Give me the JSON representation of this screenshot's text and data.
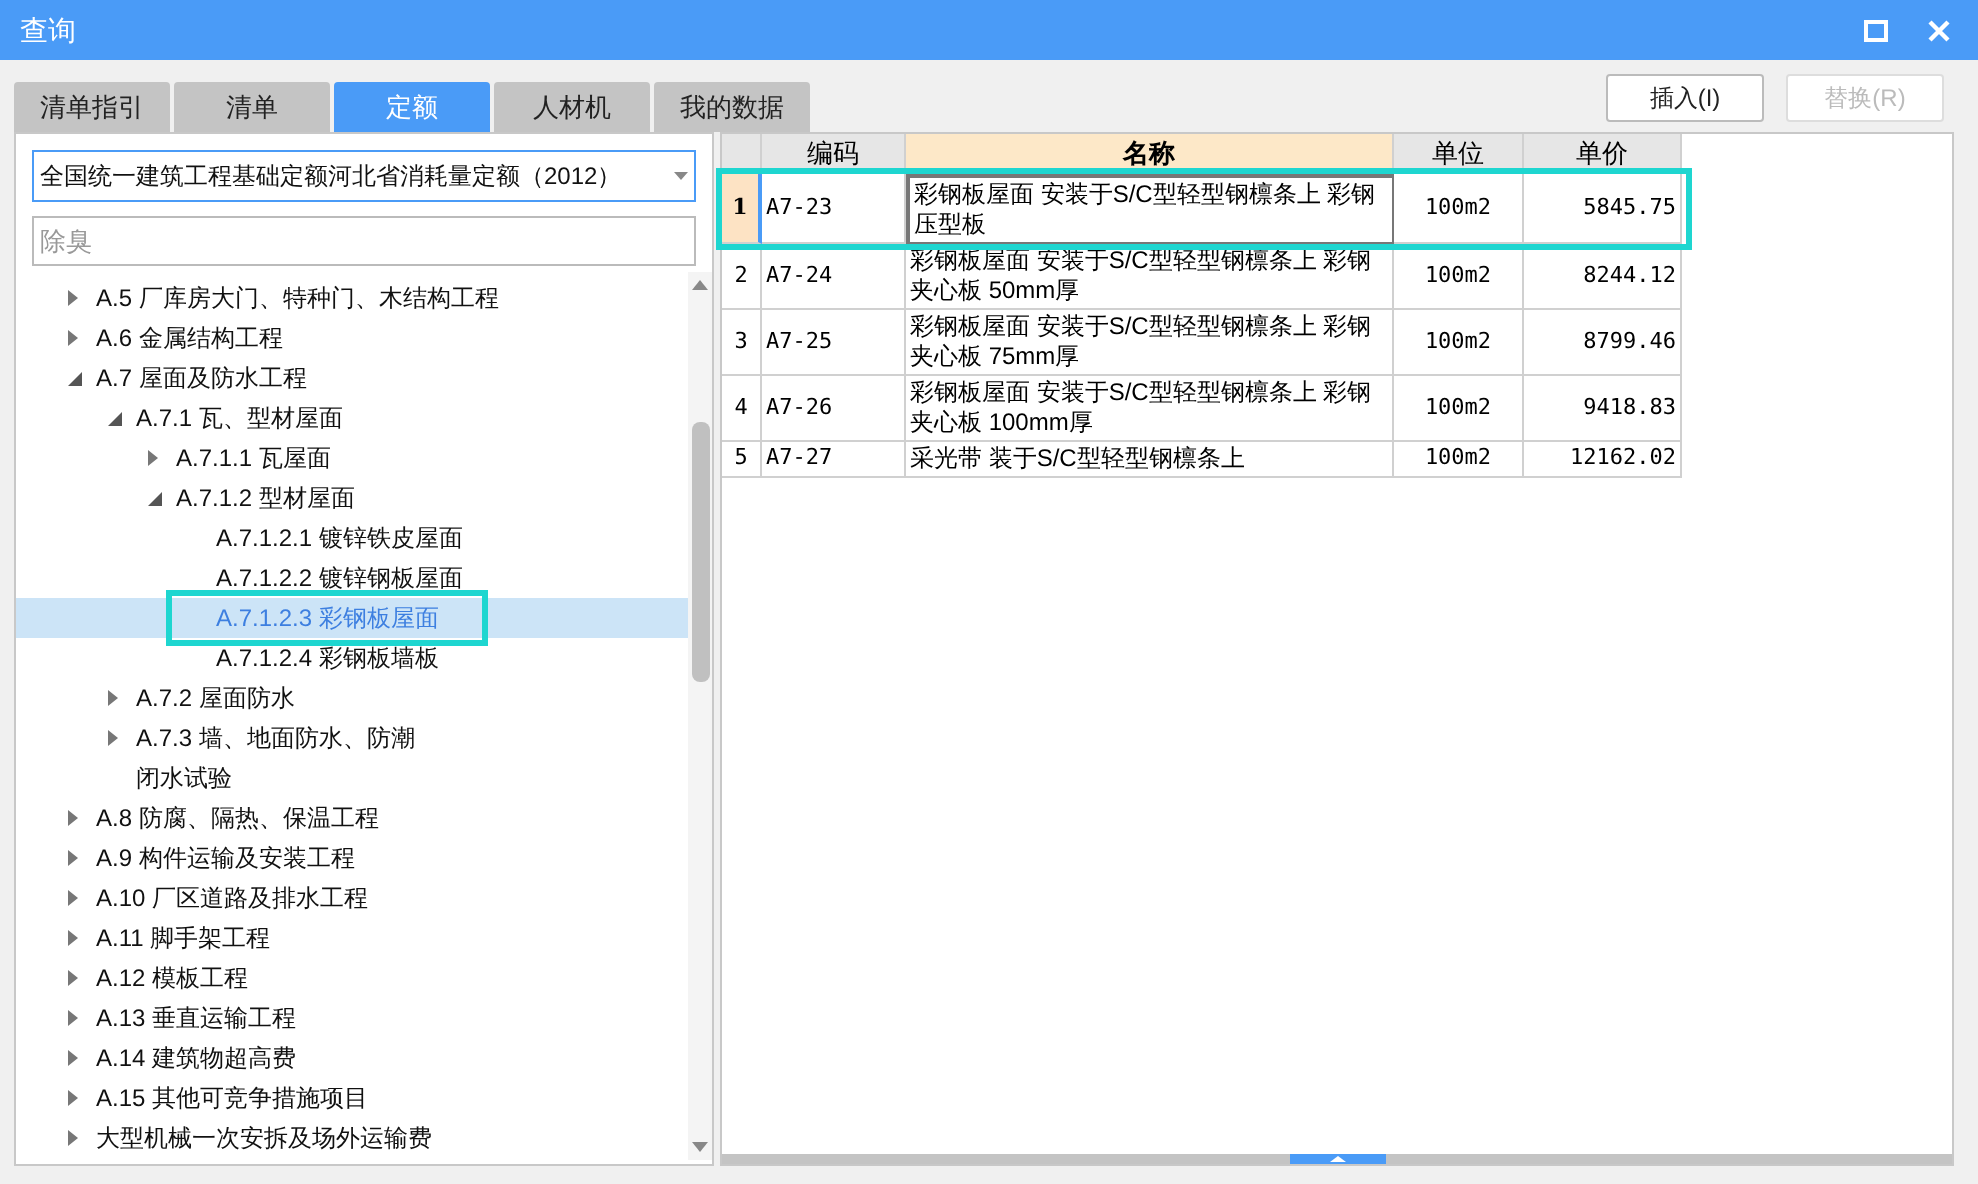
{
  "window": {
    "title": "查询"
  },
  "tabs": [
    {
      "label": "清单指引",
      "selected": false
    },
    {
      "label": "清单",
      "selected": false
    },
    {
      "label": "定额",
      "selected": true
    },
    {
      "label": "人材机",
      "selected": false
    },
    {
      "label": "我的数据",
      "selected": false
    }
  ],
  "buttons": [
    {
      "label": "插入(I)",
      "disabled": false
    },
    {
      "label": "替换(R)",
      "disabled": true
    }
  ],
  "quota_select": {
    "value": "全国统一建筑工程基础定额河北省消耗量定额（2012）"
  },
  "search": {
    "value": "除臭"
  },
  "tree": [
    {
      "label": "A.5 厂库房大门、特种门、木结构工程",
      "expanded": false,
      "selected": false
    },
    {
      "label": "A.6 金属结构工程",
      "expanded": false,
      "selected": false
    },
    {
      "label": "A.7 屋面及防水工程",
      "expanded": true,
      "selected": false,
      "children": [
        {
          "label": "A.7.1 瓦、型材屋面",
          "expanded": true,
          "selected": false,
          "children": [
            {
              "label": "A.7.1.1 瓦屋面",
              "expanded": false,
              "selected": false
            },
            {
              "label": "A.7.1.2 型材屋面",
              "expanded": true,
              "selected": false,
              "children": [
                {
                  "label": "A.7.1.2.1 镀锌铁皮屋面",
                  "selected": false
                },
                {
                  "label": "A.7.1.2.2 镀锌钢板屋面",
                  "selected": false
                },
                {
                  "label": "A.7.1.2.3 彩钢板屋面",
                  "selected": true,
                  "marked": true
                },
                {
                  "label": "A.7.1.2.4 彩钢板墙板",
                  "selected": false
                }
              ]
            }
          ]
        },
        {
          "label": "A.7.2 屋面防水",
          "expanded": false,
          "selected": false
        },
        {
          "label": "A.7.3 墙、地面防水、防潮",
          "expanded": false,
          "selected": false
        },
        {
          "label": "闭水试验",
          "selected": false
        }
      ]
    },
    {
      "label": "A.8 防腐、隔热、保温工程",
      "expanded": false,
      "selected": false
    },
    {
      "label": "A.9 构件运输及安装工程",
      "expanded": false,
      "selected": false
    },
    {
      "label": "A.10 厂区道路及排水工程",
      "expanded": false,
      "selected": false
    },
    {
      "label": "A.11 脚手架工程",
      "expanded": false,
      "selected": false
    },
    {
      "label": "A.12 模板工程",
      "expanded": false,
      "selected": false
    },
    {
      "label": "A.13 垂直运输工程",
      "expanded": false,
      "selected": false
    },
    {
      "label": "A.14 建筑物超高费",
      "expanded": false,
      "selected": false
    },
    {
      "label": "A.15 其他可竞争措施项目",
      "expanded": false,
      "selected": false
    },
    {
      "label": "大型机械一次安拆及场外运输费",
      "expanded": false,
      "selected": false
    }
  ],
  "table": {
    "columns": [
      {
        "label": "编码",
        "selected": false
      },
      {
        "label": "名称",
        "selected": true
      },
      {
        "label": "单位",
        "selected": false
      },
      {
        "label": "单价",
        "selected": false
      }
    ],
    "rows": [
      {
        "index": "1",
        "code": "A7-23",
        "name": "彩钢板屋面 安装于S/C型轻型钢檩条上 彩钢压型板",
        "unit": "100m2",
        "price": "5845.75",
        "selected": true,
        "marked": true
      },
      {
        "index": "2",
        "code": "A7-24",
        "name": "彩钢板屋面 安装于S/C型轻型钢檩条上 彩钢夹心板 50mm厚",
        "unit": "100m2",
        "price": "8244.12",
        "selected": false,
        "marked": false
      },
      {
        "index": "3",
        "code": "A7-25",
        "name": "彩钢板屋面 安装于S/C型轻型钢檩条上 彩钢夹心板 75mm厚",
        "unit": "100m2",
        "price": "8799.46",
        "selected": false,
        "marked": false
      },
      {
        "index": "4",
        "code": "A7-26",
        "name": "彩钢板屋面 安装于S/C型轻型钢檩条上 彩钢夹心板 100mm厚",
        "unit": "100m2",
        "price": "9418.83",
        "selected": false,
        "marked": false
      },
      {
        "index": "5",
        "code": "A7-27",
        "name": "采光带 装于S/C型轻型钢檩条上",
        "unit": "100m2",
        "price": "12162.02",
        "selected": false,
        "marked": false
      }
    ]
  }
}
